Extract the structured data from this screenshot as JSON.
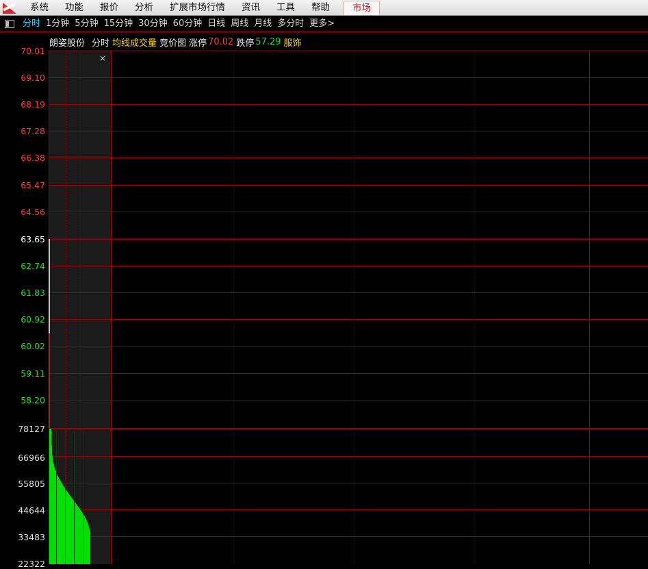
{
  "menu": {
    "items": [
      "系统",
      "功能",
      "报价",
      "分析",
      "扩展市场行情",
      "资讯",
      "工具",
      "帮助"
    ],
    "market_tab": "市场"
  },
  "periods": {
    "items": [
      "分时",
      "1分钟",
      "5分钟",
      "15分钟",
      "30分钟",
      "60分钟",
      "日线",
      "周线",
      "月线",
      "多分时",
      "更多>"
    ],
    "active_index": 0
  },
  "info": {
    "stock_name": "朗姿股份",
    "mode": "分时",
    "avg_line": "均线",
    "volume": "成交量",
    "auction": "竞价图",
    "limit_up_label": "涨停",
    "limit_up_value": "70.02",
    "limit_down_label": "跌停",
    "limit_down_value": "57.29",
    "sector": "服饰"
  },
  "close_glyph": "×",
  "price_axis": {
    "labels": [
      "70.01",
      "69.10",
      "68.19",
      "67.28",
      "66.38",
      "65.47",
      "64.56",
      "63.65",
      "62.74",
      "61.83",
      "60.92",
      "60.02",
      "59.11",
      "58.20"
    ],
    "prev_close": "63.65"
  },
  "volume_axis": {
    "labels": [
      "78127",
      "66966",
      "55805",
      "44644",
      "33483",
      "22322"
    ]
  },
  "colors": {
    "grid": "#a00000",
    "up": "#ff3b3b",
    "down": "#1ee01e",
    "neutral": "#ffffff",
    "volume_bar": "#00e000",
    "avg_line": "#ffd700",
    "active_tab": "#27d7ff"
  },
  "chart_data": {
    "type": "bar",
    "title": "",
    "auction_volume_ylim": [
      22322,
      78127
    ],
    "auction_volume_samples": [
      78127,
      78127,
      78127,
      70500,
      66000,
      63000,
      62000,
      60500,
      59500,
      58800,
      58000,
      57200,
      56500,
      55800,
      55300,
      54800,
      54200,
      53700,
      53100,
      52600,
      52000,
      51600,
      51100,
      50600,
      50100,
      49600,
      49200,
      48700,
      48300,
      47900,
      47400,
      47000,
      46600,
      46100,
      45700,
      45300,
      44900,
      44500,
      44100,
      43600,
      43200,
      42800,
      42400,
      41900,
      41500,
      41000,
      40600,
      40100,
      39600,
      39100,
      38600,
      38000,
      37500,
      36900,
      36200,
      35500,
      34700,
      33600,
      32500,
      31000
    ]
  }
}
